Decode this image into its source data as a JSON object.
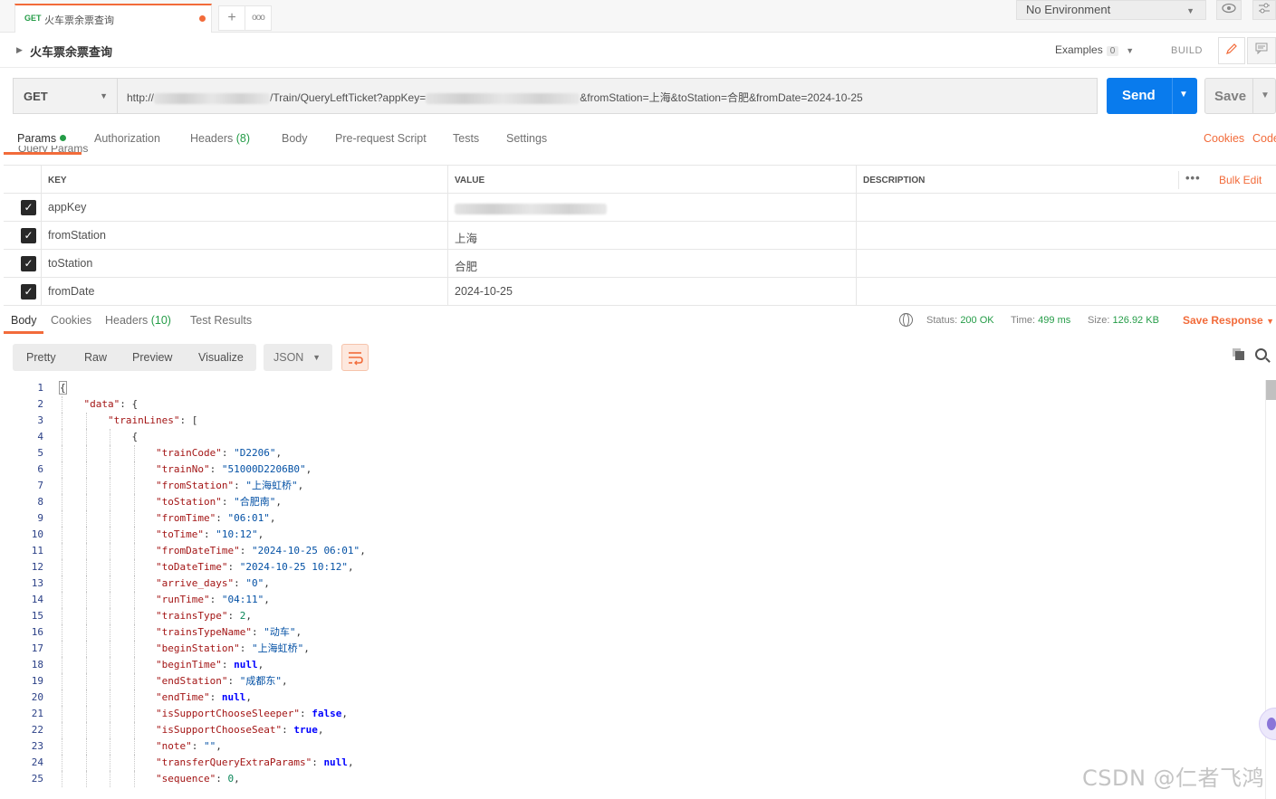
{
  "tab": {
    "method": "GET",
    "name": "火车票余票查询"
  },
  "environment": {
    "label": "No Environment"
  },
  "request": {
    "title": "火车票余票查询",
    "examples_label": "Examples",
    "examples_count": "0",
    "build_label": "BUILD",
    "method": "GET",
    "url_prefix": "http://",
    "url_mid": "/Train/QueryLeftTicket?appKey=",
    "url_suffix": "&fromStation=上海&toStation=合肥&fromDate=2024-10-25",
    "send_label": "Send",
    "save_label": "Save"
  },
  "subtabs": {
    "params": "Params",
    "authorization": "Authorization",
    "headers": "Headers",
    "headers_count": "(8)",
    "body": "Body",
    "prerequest": "Pre-request Script",
    "tests": "Tests",
    "settings": "Settings",
    "cookies": "Cookies",
    "code": "Code",
    "hidden_label": "Query Params"
  },
  "params_table": {
    "headers": {
      "key": "KEY",
      "value": "VALUE",
      "description": "DESCRIPTION",
      "bulk_edit": "Bulk Edit"
    },
    "rows": [
      {
        "key": "appKey",
        "value": "",
        "checked": true
      },
      {
        "key": "fromStation",
        "value": "上海",
        "checked": true
      },
      {
        "key": "toStation",
        "value": "合肥",
        "checked": true
      },
      {
        "key": "fromDate",
        "value": "2024-10-25",
        "checked": true
      }
    ]
  },
  "response": {
    "tabs": {
      "body": "Body",
      "cookies": "Cookies",
      "headers": "Headers",
      "headers_count": "(10)",
      "test_results": "Test Results"
    },
    "status_label": "Status:",
    "status_value": "200 OK",
    "time_label": "Time:",
    "time_value": "499 ms",
    "size_label": "Size:",
    "size_value": "126.92 KB",
    "save_response": "Save Response",
    "views": {
      "pretty": "Pretty",
      "raw": "Raw",
      "preview": "Preview",
      "visualize": "Visualize"
    },
    "format": "JSON"
  },
  "code_lines": [
    {
      "n": "1",
      "indent": 0,
      "parts": [
        [
          "p",
          "{"
        ]
      ]
    },
    {
      "n": "2",
      "indent": 1,
      "parts": [
        [
          "k",
          "\"data\""
        ],
        [
          "p",
          ": {"
        ]
      ]
    },
    {
      "n": "3",
      "indent": 2,
      "parts": [
        [
          "k",
          "\"trainLines\""
        ],
        [
          "p",
          ": ["
        ]
      ]
    },
    {
      "n": "4",
      "indent": 3,
      "parts": [
        [
          "p",
          "{"
        ]
      ]
    },
    {
      "n": "5",
      "indent": 4,
      "parts": [
        [
          "k",
          "\"trainCode\""
        ],
        [
          "p",
          ": "
        ],
        [
          "s",
          "\"D2206\""
        ],
        [
          "p",
          ","
        ]
      ]
    },
    {
      "n": "6",
      "indent": 4,
      "parts": [
        [
          "k",
          "\"trainNo\""
        ],
        [
          "p",
          ": "
        ],
        [
          "s",
          "\"51000D2206B0\""
        ],
        [
          "p",
          ","
        ]
      ]
    },
    {
      "n": "7",
      "indent": 4,
      "parts": [
        [
          "k",
          "\"fromStation\""
        ],
        [
          "p",
          ": "
        ],
        [
          "s",
          "\"上海虹桥\""
        ],
        [
          "p",
          ","
        ]
      ]
    },
    {
      "n": "8",
      "indent": 4,
      "parts": [
        [
          "k",
          "\"toStation\""
        ],
        [
          "p",
          ": "
        ],
        [
          "s",
          "\"合肥南\""
        ],
        [
          "p",
          ","
        ]
      ]
    },
    {
      "n": "9",
      "indent": 4,
      "parts": [
        [
          "k",
          "\"fromTime\""
        ],
        [
          "p",
          ": "
        ],
        [
          "s",
          "\"06:01\""
        ],
        [
          "p",
          ","
        ]
      ]
    },
    {
      "n": "10",
      "indent": 4,
      "parts": [
        [
          "k",
          "\"toTime\""
        ],
        [
          "p",
          ": "
        ],
        [
          "s",
          "\"10:12\""
        ],
        [
          "p",
          ","
        ]
      ]
    },
    {
      "n": "11",
      "indent": 4,
      "parts": [
        [
          "k",
          "\"fromDateTime\""
        ],
        [
          "p",
          ": "
        ],
        [
          "s",
          "\"2024-10-25 06:01\""
        ],
        [
          "p",
          ","
        ]
      ]
    },
    {
      "n": "12",
      "indent": 4,
      "parts": [
        [
          "k",
          "\"toDateTime\""
        ],
        [
          "p",
          ": "
        ],
        [
          "s",
          "\"2024-10-25 10:12\""
        ],
        [
          "p",
          ","
        ]
      ]
    },
    {
      "n": "13",
      "indent": 4,
      "parts": [
        [
          "k",
          "\"arrive_days\""
        ],
        [
          "p",
          ": "
        ],
        [
          "s",
          "\"0\""
        ],
        [
          "p",
          ","
        ]
      ]
    },
    {
      "n": "14",
      "indent": 4,
      "parts": [
        [
          "k",
          "\"runTime\""
        ],
        [
          "p",
          ": "
        ],
        [
          "s",
          "\"04:11\""
        ],
        [
          "p",
          ","
        ]
      ]
    },
    {
      "n": "15",
      "indent": 4,
      "parts": [
        [
          "k",
          "\"trainsType\""
        ],
        [
          "p",
          ": "
        ],
        [
          "n",
          "2"
        ],
        [
          "p",
          ","
        ]
      ]
    },
    {
      "n": "16",
      "indent": 4,
      "parts": [
        [
          "k",
          "\"trainsTypeName\""
        ],
        [
          "p",
          ": "
        ],
        [
          "s",
          "\"动车\""
        ],
        [
          "p",
          ","
        ]
      ]
    },
    {
      "n": "17",
      "indent": 4,
      "parts": [
        [
          "k",
          "\"beginStation\""
        ],
        [
          "p",
          ": "
        ],
        [
          "s",
          "\"上海虹桥\""
        ],
        [
          "p",
          ","
        ]
      ]
    },
    {
      "n": "18",
      "indent": 4,
      "parts": [
        [
          "k",
          "\"beginTime\""
        ],
        [
          "p",
          ": "
        ],
        [
          "w",
          "null"
        ],
        [
          "p",
          ","
        ]
      ]
    },
    {
      "n": "19",
      "indent": 4,
      "parts": [
        [
          "k",
          "\"endStation\""
        ],
        [
          "p",
          ": "
        ],
        [
          "s",
          "\"成都东\""
        ],
        [
          "p",
          ","
        ]
      ]
    },
    {
      "n": "20",
      "indent": 4,
      "parts": [
        [
          "k",
          "\"endTime\""
        ],
        [
          "p",
          ": "
        ],
        [
          "w",
          "null"
        ],
        [
          "p",
          ","
        ]
      ]
    },
    {
      "n": "21",
      "indent": 4,
      "parts": [
        [
          "k",
          "\"isSupportChooseSleeper\""
        ],
        [
          "p",
          ": "
        ],
        [
          "w",
          "false"
        ],
        [
          "p",
          ","
        ]
      ]
    },
    {
      "n": "22",
      "indent": 4,
      "parts": [
        [
          "k",
          "\"isSupportChooseSeat\""
        ],
        [
          "p",
          ": "
        ],
        [
          "w",
          "true"
        ],
        [
          "p",
          ","
        ]
      ]
    },
    {
      "n": "23",
      "indent": 4,
      "parts": [
        [
          "k",
          "\"note\""
        ],
        [
          "p",
          ": "
        ],
        [
          "s",
          "\"\""
        ],
        [
          "p",
          ","
        ]
      ]
    },
    {
      "n": "24",
      "indent": 4,
      "parts": [
        [
          "k",
          "\"transferQueryExtraParams\""
        ],
        [
          "p",
          ": "
        ],
        [
          "w",
          "null"
        ],
        [
          "p",
          ","
        ]
      ]
    },
    {
      "n": "25",
      "indent": 4,
      "parts": [
        [
          "k",
          "\"sequence\""
        ],
        [
          "p",
          ": "
        ],
        [
          "n",
          "0"
        ],
        [
          "p",
          ","
        ]
      ]
    }
  ],
  "watermark": "CSDN @仁者飞鸿",
  "colors": {
    "accent": "#f26b3a",
    "send": "#097bed",
    "ok": "#249c47"
  }
}
